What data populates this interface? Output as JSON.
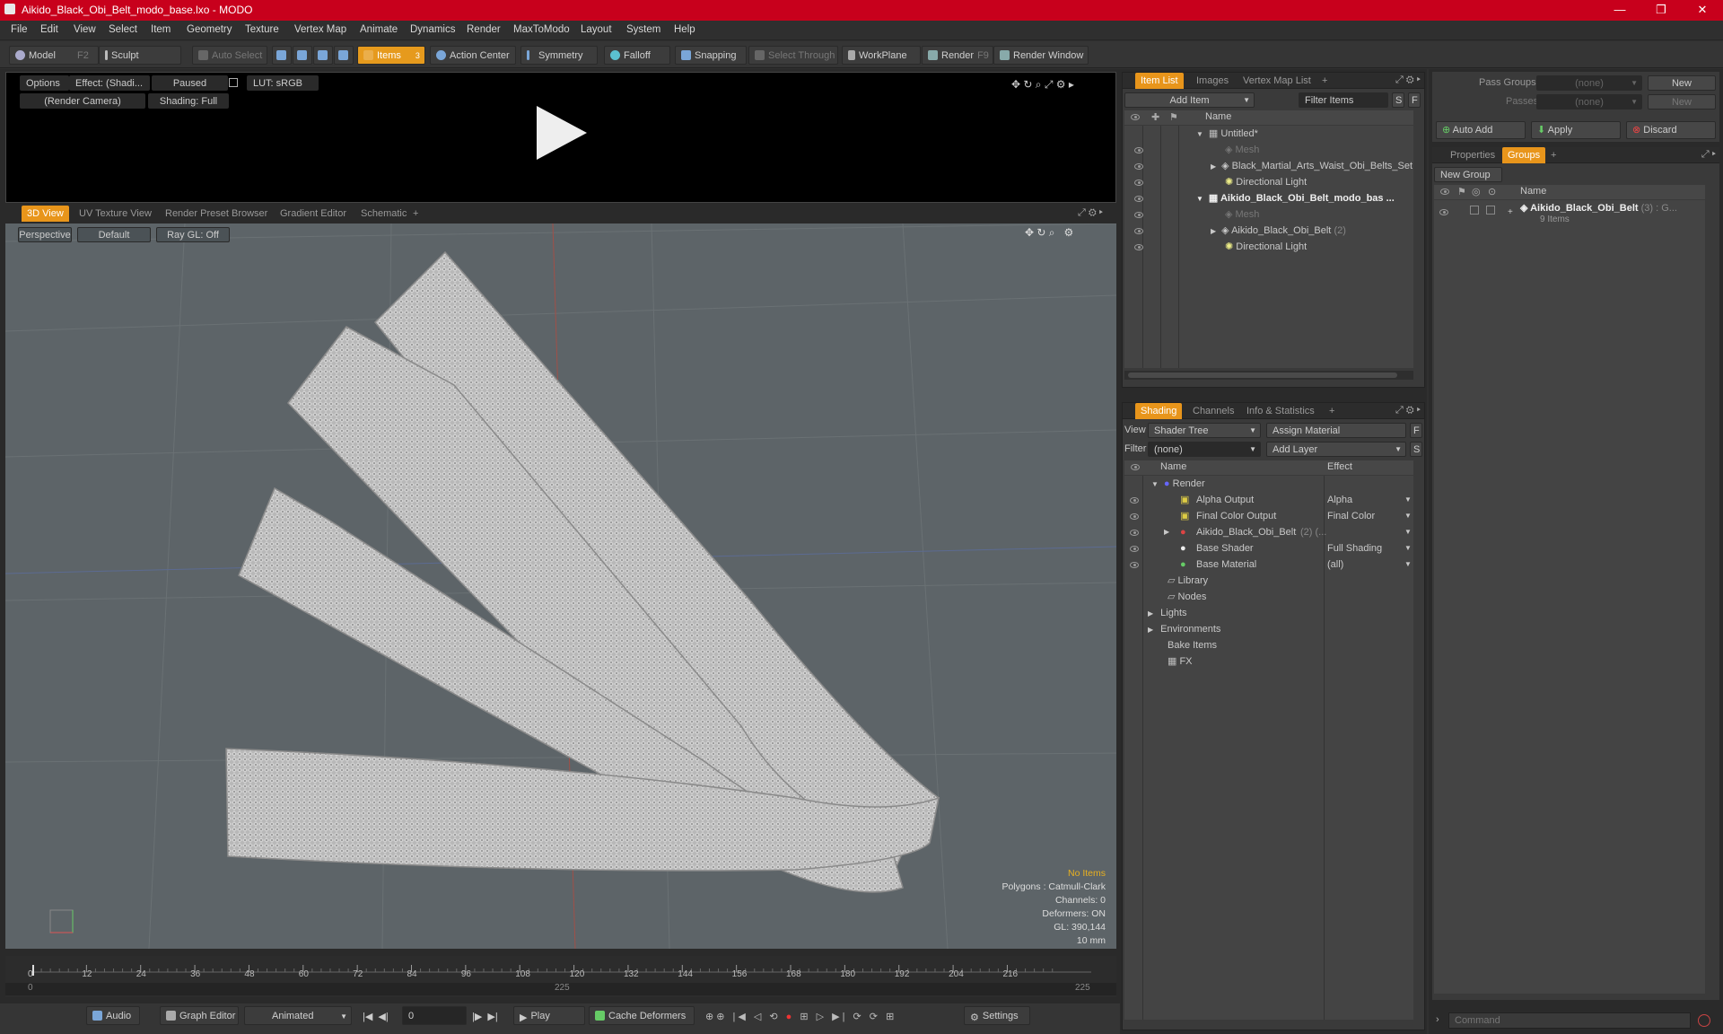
{
  "window": {
    "title": "Aikido_Black_Obi_Belt_modo_base.lxo - MODO",
    "min": "—",
    "max": "❐",
    "close": "✕"
  },
  "menu": [
    "File",
    "Edit",
    "View",
    "Select",
    "Item",
    "Geometry",
    "Texture",
    "Vertex Map",
    "Animate",
    "Dynamics",
    "Render",
    "MaxToModo",
    "Layout",
    "System",
    "Help"
  ],
  "toolbar": {
    "model": "Model",
    "model_key": "F2",
    "sculpt": "Sculpt",
    "auto_select": "Auto Select",
    "items": "Items",
    "items_count": "3",
    "action_center": "Action Center",
    "symmetry": "Symmetry",
    "falloff": "Falloff",
    "snapping": "Snapping",
    "select_through": "Select Through",
    "workplane": "WorkPlane",
    "render": "Render",
    "render_key": "F9",
    "render_window": "Render Window"
  },
  "preview": {
    "options": "Options",
    "effect": "Effect: (Shadi...",
    "paused": "Paused",
    "lut": "LUT: sRGB",
    "camera": "(Render Camera)",
    "shading": "Shading: Full"
  },
  "viewport_tabs": [
    "3D View",
    "UV Texture View",
    "Render Preset Browser",
    "Gradient Editor",
    "Schematic",
    "+"
  ],
  "viewport": {
    "perspective": "Perspective",
    "default": "Default",
    "raygl": "Ray GL: Off",
    "info": {
      "no_items": "No Items",
      "polygons": "Polygons : Catmull-Clark",
      "channels": "Channels: 0",
      "deformers": "Deformers: ON",
      "gl": "GL: 390,144",
      "unit": "10 mm"
    }
  },
  "timeline": {
    "ticks": [
      "0",
      "12",
      "24",
      "36",
      "48",
      "60",
      "72",
      "84",
      "96",
      "108",
      "120",
      "132",
      "144",
      "156",
      "168",
      "180",
      "192",
      "204",
      "216"
    ],
    "start": "0",
    "mid": "225",
    "end": "225"
  },
  "bottombar": {
    "audio": "Audio",
    "graph_editor": "Graph Editor",
    "animated": "Animated",
    "frame": "0",
    "play": "Play",
    "cache": "Cache Deformers",
    "settings": "Settings"
  },
  "itemlist": {
    "tabs": [
      "Item List",
      "Images",
      "Vertex Map List",
      "+"
    ],
    "add_item": "Add Item",
    "filter": "Filter Items",
    "s": "S",
    "f": "F",
    "col_name": "Name",
    "rows": [
      {
        "label": "Untitled*",
        "suffix": ""
      },
      {
        "label": "Mesh",
        "suffix": ""
      },
      {
        "label": "Black_Martial_Arts_Waist_Obi_Belts_Set",
        "suffix": ""
      },
      {
        "label": "Directional Light",
        "suffix": ""
      },
      {
        "label": "Aikido_Black_Obi_Belt_modo_bas ...",
        "suffix": ""
      },
      {
        "label": "Mesh",
        "suffix": ""
      },
      {
        "label": "Aikido_Black_Obi_Belt",
        "suffix": "(2)"
      },
      {
        "label": "Directional Light",
        "suffix": ""
      }
    ]
  },
  "shading": {
    "tabs": [
      "Shading",
      "Channels",
      "Info & Statistics",
      "+"
    ],
    "view_label": "View",
    "view": "Shader Tree",
    "assign": "Assign Material",
    "f": "F",
    "filter_label": "Filter",
    "filter": "(none)",
    "add_layer": "Add Layer",
    "s": "S",
    "col_name": "Name",
    "col_effect": "Effect",
    "rows": [
      {
        "label": "Render",
        "effect": ""
      },
      {
        "label": "Alpha Output",
        "effect": "Alpha"
      },
      {
        "label": "Final Color Output",
        "effect": "Final Color"
      },
      {
        "label": "Aikido_Black_Obi_Belt",
        "suffix": "(2) (...",
        "effect": ""
      },
      {
        "label": "Base Shader",
        "effect": "Full Shading"
      },
      {
        "label": "Base Material",
        "effect": "(all)"
      },
      {
        "label": "Library",
        "effect": ""
      },
      {
        "label": "Nodes",
        "effect": ""
      },
      {
        "label": "Lights",
        "effect": ""
      },
      {
        "label": "Environments",
        "effect": ""
      },
      {
        "label": "Bake Items",
        "effect": ""
      },
      {
        "label": "FX",
        "effect": ""
      }
    ]
  },
  "groups": {
    "pass_groups": "Pass Groups",
    "pass_value": "(none)",
    "passes": "Passes",
    "passes_value": "(none)",
    "new": "New",
    "auto_add": "Auto Add",
    "apply": "Apply",
    "discard": "Discard",
    "tabs": [
      "Properties",
      "Groups",
      "+"
    ],
    "new_group": "New Group",
    "col_name": "Name",
    "group_name": "Aikido_Black_Obi_Belt",
    "group_suffix": "(3) : G...",
    "group_items": "9 Items"
  },
  "command": {
    "placeholder": "Command"
  }
}
